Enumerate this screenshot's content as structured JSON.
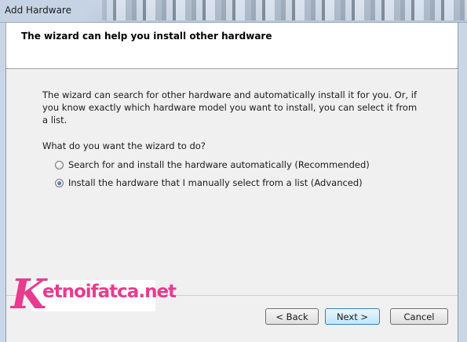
{
  "window": {
    "title": "Add Hardware"
  },
  "header": {
    "title": "The wizard can help you install other hardware"
  },
  "content": {
    "description": "The wizard can search for other hardware and automatically install it for you. Or, if you know exactly which hardware model you want to install, you can select it from a list.",
    "question": "What do you want the wizard to do?",
    "options": [
      {
        "label": "Search for and install the hardware automatically (Recommended)",
        "selected": false
      },
      {
        "label": "Install the hardware that I manually select from a list (Advanced)",
        "selected": true
      }
    ]
  },
  "buttons": {
    "back": "< Back",
    "next": "Next >",
    "cancel": "Cancel"
  },
  "watermark": {
    "k": "K",
    "rest": "etnoifatca.net"
  }
}
